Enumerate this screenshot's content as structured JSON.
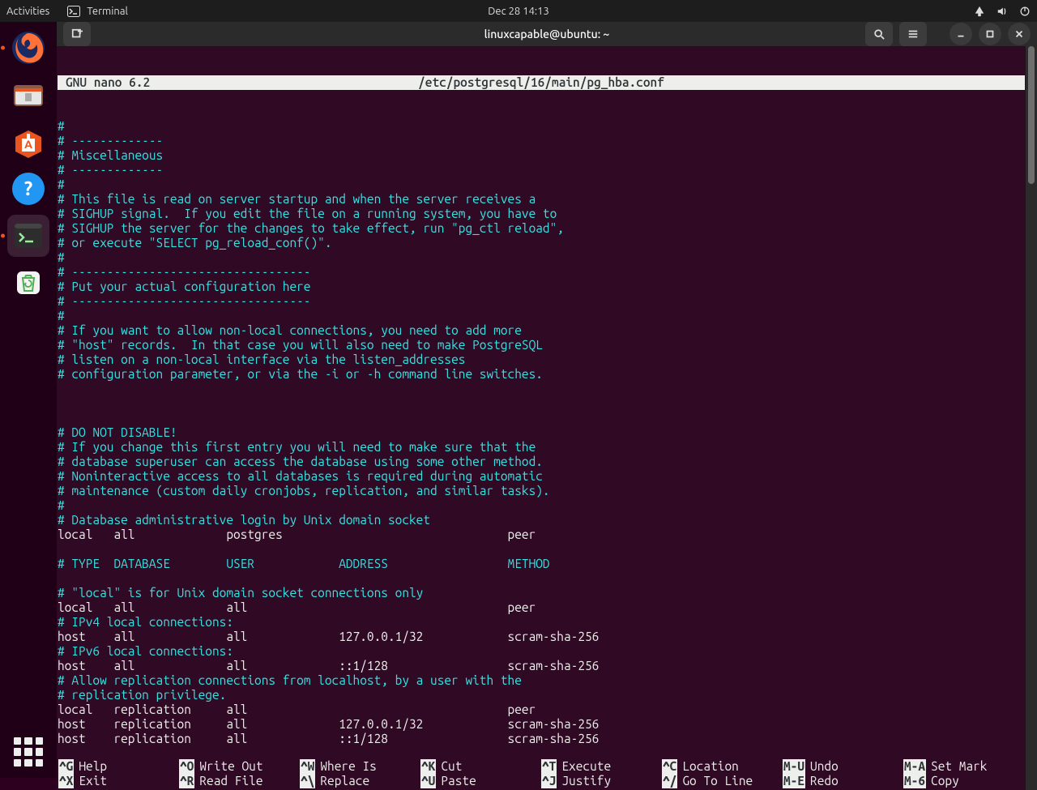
{
  "top_panel": {
    "activities": "Activities",
    "app_label": "Terminal",
    "clock": "Dec 28  14:13"
  },
  "dock": {
    "items": [
      "firefox",
      "files",
      "software",
      "help",
      "terminal",
      "trash"
    ]
  },
  "window": {
    "title": "linuxcapable@ubuntu: ~"
  },
  "nano": {
    "app": "GNU nano 6.2",
    "file": "/etc/postgresql/16/main/pg_hba.conf",
    "lines": [
      {
        "c": "cmt",
        "t": "#"
      },
      {
        "c": "cmt",
        "t": "# -------------"
      },
      {
        "c": "cmt",
        "t": "# Miscellaneous"
      },
      {
        "c": "cmt",
        "t": "# -------------"
      },
      {
        "c": "cmt",
        "t": "#"
      },
      {
        "c": "cmt",
        "t": "# This file is read on server startup and when the server receives a"
      },
      {
        "c": "cmt",
        "t": "# SIGHUP signal.  If you edit the file on a running system, you have to"
      },
      {
        "c": "cmt",
        "t": "# SIGHUP the server for the changes to take effect, run \"pg_ctl reload\","
      },
      {
        "c": "cmt",
        "t": "# or execute \"SELECT pg_reload_conf()\"."
      },
      {
        "c": "cmt",
        "t": "#"
      },
      {
        "c": "cmt",
        "t": "# ----------------------------------"
      },
      {
        "c": "cmt",
        "t": "# Put your actual configuration here"
      },
      {
        "c": "cmt",
        "t": "# ----------------------------------"
      },
      {
        "c": "cmt",
        "t": "#"
      },
      {
        "c": "cmt",
        "t": "# If you want to allow non-local connections, you need to add more"
      },
      {
        "c": "cmt",
        "t": "# \"host\" records.  In that case you will also need to make PostgreSQL"
      },
      {
        "c": "cmt",
        "t": "# listen on a non-local interface via the listen_addresses"
      },
      {
        "c": "cmt",
        "t": "# configuration parameter, or via the -i or -h command line switches."
      },
      {
        "c": "txt",
        "t": ""
      },
      {
        "c": "txt",
        "t": ""
      },
      {
        "c": "txt",
        "t": ""
      },
      {
        "c": "cmt",
        "t": "# DO NOT DISABLE!"
      },
      {
        "c": "cmt",
        "t": "# If you change this first entry you will need to make sure that the"
      },
      {
        "c": "cmt",
        "t": "# database superuser can access the database using some other method."
      },
      {
        "c": "cmt",
        "t": "# Noninteractive access to all databases is required during automatic"
      },
      {
        "c": "cmt",
        "t": "# maintenance (custom daily cronjobs, replication, and similar tasks)."
      },
      {
        "c": "cmt",
        "t": "#"
      },
      {
        "c": "cmt",
        "t": "# Database administrative login by Unix domain socket"
      },
      {
        "c": "txt",
        "t": "local   all             postgres                                peer"
      },
      {
        "c": "txt",
        "t": ""
      },
      {
        "c": "cmt",
        "t": "# TYPE  DATABASE        USER            ADDRESS                 METHOD"
      },
      {
        "c": "txt",
        "t": ""
      },
      {
        "c": "cmt",
        "t": "# \"local\" is for Unix domain socket connections only"
      },
      {
        "c": "txt",
        "t": "local   all             all                                     peer"
      },
      {
        "c": "cmt",
        "t": "# IPv4 local connections:"
      },
      {
        "c": "txt",
        "t": "host    all             all             127.0.0.1/32            scram-sha-256"
      },
      {
        "c": "cmt",
        "t": "# IPv6 local connections:"
      },
      {
        "c": "txt",
        "t": "host    all             all             ::1/128                 scram-sha-256"
      },
      {
        "c": "cmt",
        "t": "# Allow replication connections from localhost, by a user with the"
      },
      {
        "c": "cmt",
        "t": "# replication privilege."
      },
      {
        "c": "txt",
        "t": "local   replication     all                                     peer"
      },
      {
        "c": "txt",
        "t": "host    replication     all             127.0.0.1/32            scram-sha-256"
      },
      {
        "c": "txt",
        "t": "host    replication     all             ::1/128                 scram-sha-256"
      }
    ],
    "shortcuts_row1": [
      {
        "k": "^G",
        "l": "Help"
      },
      {
        "k": "^O",
        "l": "Write Out"
      },
      {
        "k": "^W",
        "l": "Where Is"
      },
      {
        "k": "^K",
        "l": "Cut"
      },
      {
        "k": "^T",
        "l": "Execute"
      },
      {
        "k": "^C",
        "l": "Location"
      },
      {
        "k": "M-U",
        "l": "Undo"
      },
      {
        "k": "M-A",
        "l": "Set Mark"
      }
    ],
    "shortcuts_row2": [
      {
        "k": "^X",
        "l": "Exit"
      },
      {
        "k": "^R",
        "l": "Read File"
      },
      {
        "k": "^\\",
        "l": "Replace"
      },
      {
        "k": "^U",
        "l": "Paste"
      },
      {
        "k": "^J",
        "l": "Justify"
      },
      {
        "k": "^/",
        "l": "Go To Line"
      },
      {
        "k": "M-E",
        "l": "Redo"
      },
      {
        "k": "M-6",
        "l": "Copy"
      }
    ]
  }
}
